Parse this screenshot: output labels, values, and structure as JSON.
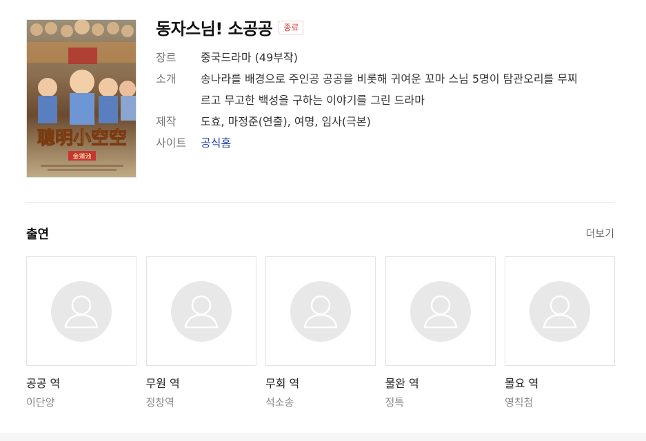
{
  "drama": {
    "title": "동자스님! 소공공",
    "status_badge": "종료"
  },
  "info": [
    {
      "label": "장르",
      "value": "중국드라마 (49부작)"
    },
    {
      "label": "소개",
      "value": "송나라를 배경으로 주인공 공공을 비롯해 귀여운 꼬마 스님 5명이 탐관오리를 무찌르고 무고한 백성을 구하는 이야기를 그린 드라마"
    },
    {
      "label": "제작",
      "value": "도효, 마정준(연출), 여명, 임사(극본)"
    },
    {
      "label": "사이트",
      "value": "공식홈"
    }
  ],
  "poster": {
    "headline_text": "聰明小空空",
    "sub_text": "金蓮池",
    "colors": {
      "top": "#a49a86",
      "mid": "#7c5a3a",
      "bottom": "#b8a482",
      "title_gold": "#f2cf6a"
    }
  },
  "cast_section": {
    "title": "출연",
    "more_label": "더보기",
    "members": [
      {
        "role": "공공 역",
        "actor": "이단양"
      },
      {
        "role": "무원 역",
        "actor": "정창역"
      },
      {
        "role": "무회 역",
        "actor": "석소송"
      },
      {
        "role": "물완 역",
        "actor": "정특"
      },
      {
        "role": "몰요 역",
        "actor": "영칙첨"
      }
    ]
  },
  "icons": {
    "avatar_placeholder": "person-silhouette-icon"
  }
}
